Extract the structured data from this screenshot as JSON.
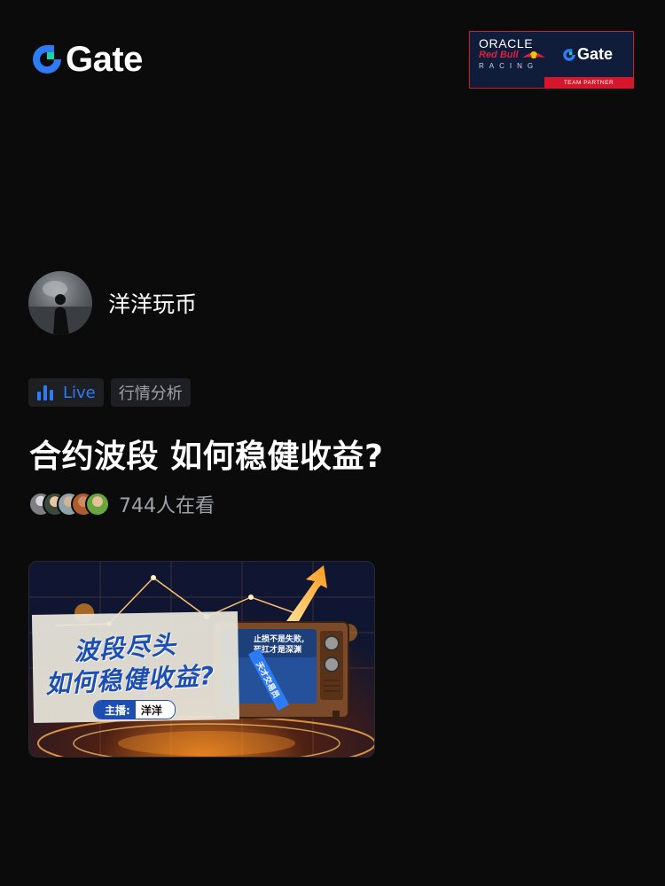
{
  "brand": {
    "name": "Gate",
    "accent": "#2d7cf6"
  },
  "partner_badge": {
    "oracle": "ORACLE",
    "redbull": "Red Bull",
    "racing": "RACING",
    "gate": "Gate",
    "team_partner": "TEAM PARTNER",
    "color": "#d8162b"
  },
  "host": {
    "name": "洋洋玩币"
  },
  "tags": {
    "live": "Live",
    "category": "行情分析"
  },
  "stream": {
    "title": "合约波段 如何稳健收益?"
  },
  "viewers": {
    "count_text": "744人在看"
  },
  "cover": {
    "headline_1": "波段尽头",
    "headline_2": "如何稳健收益?",
    "host_key": "主播:",
    "host_value": "洋洋",
    "tv_line_1": "止损不是失败,",
    "tv_line_2": "死扛才是深渊",
    "tv_banner": "天才交易员"
  }
}
